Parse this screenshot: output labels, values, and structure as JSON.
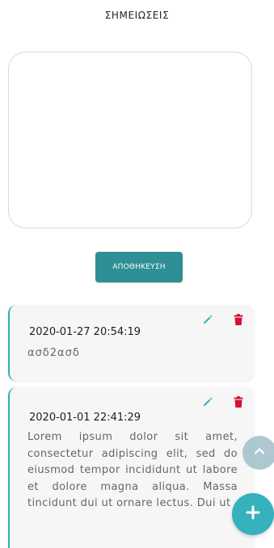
{
  "header": {
    "title": "ΣΗΜΕΙΩΣΕΙΣ"
  },
  "editor": {
    "value": "",
    "placeholder": ""
  },
  "actions": {
    "save_label": "ΑΠΟΘΗΚΕΥΣΗ"
  },
  "notes": [
    {
      "date": "2020-01-27 20:54:19",
      "text": "ασδ2ασδ"
    },
    {
      "date": "2020-01-01 22:41:29",
      "text": "Lorem ipsum dolor sit amet, consectetur adipiscing elit, sed do eiusmod tempor incididunt ut labore et dolore magna aliqua. Massa tincidunt dui ut ornare lectus. Dui ut"
    }
  ],
  "colors": {
    "accent": "#2f8f96",
    "fab": "#36b2bd",
    "card_border": "#2fb0b8",
    "edit_icon": "#3ab3c0",
    "delete_icon": "#d3132f"
  },
  "icons": {
    "edit": "pencil-icon",
    "delete": "trash-icon",
    "scroll_up": "chevron-up-icon",
    "add": "plus-icon"
  }
}
